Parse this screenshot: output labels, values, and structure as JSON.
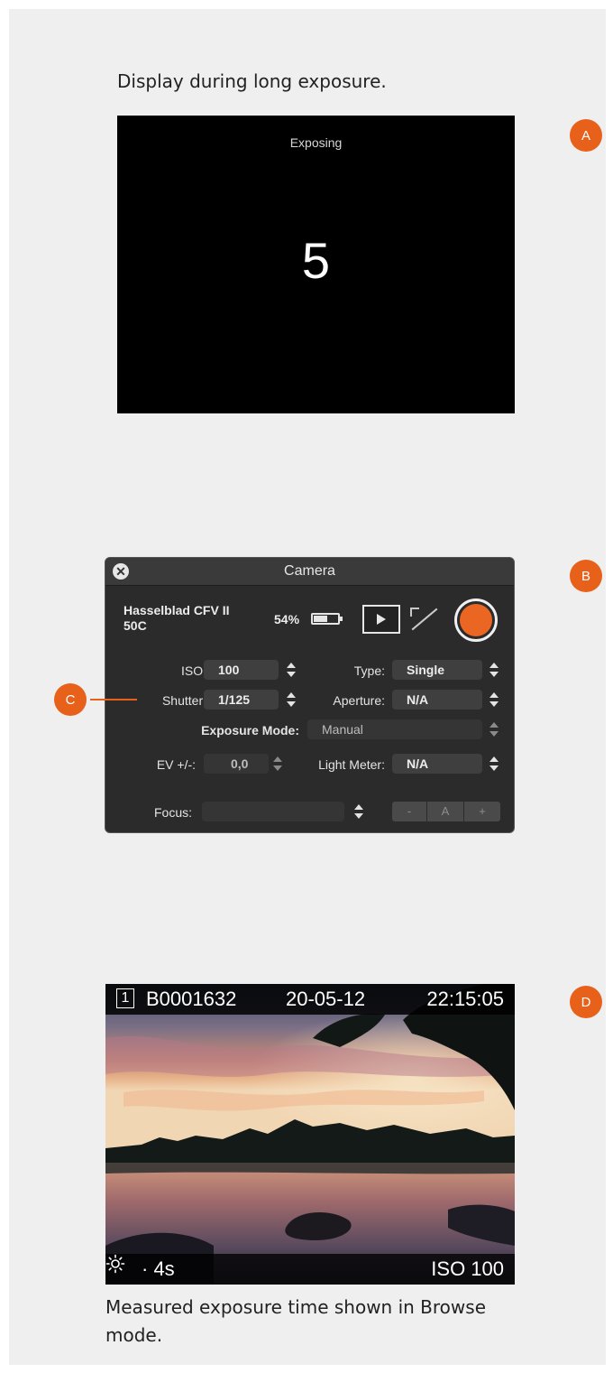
{
  "captions": {
    "top": "Display during long exposure.",
    "bottom": "Measured exposure time shown in Browse mode."
  },
  "badges": {
    "a": "A",
    "b": "B",
    "c": "C",
    "d": "D"
  },
  "screen_a": {
    "status": "Exposing",
    "countdown": "5"
  },
  "panel": {
    "title": "Camera",
    "camera_name": "Hasselblad CFV II 50C",
    "battery_pct": "54%",
    "battery_level": 0.54,
    "iso_label": "ISO:",
    "iso_value": "100",
    "type_label": "Type:",
    "type_value": "Single",
    "shutter_label": "Shutter:",
    "shutter_value": "1/125",
    "aperture_label": "Aperture:",
    "aperture_value": "N/A",
    "exposure_mode_label": "Exposure Mode:",
    "exposure_mode_value": "Manual",
    "ev_label": "EV +/-:",
    "ev_value": "0,0",
    "light_meter_label": "Light Meter:",
    "light_meter_value": "N/A",
    "focus_label": "Focus:",
    "focus_value": "",
    "focus_minus": "-",
    "focus_auto": "A",
    "focus_plus": "+"
  },
  "photo": {
    "slot": "1",
    "image_name": "B0001632",
    "date": "20-05-12",
    "time": "22:15:05",
    "exposure_time": "· 4s",
    "iso": "ISO 100",
    "mode_icon": "sun-icon"
  },
  "colors": {
    "accent": "#e8611a",
    "panel_bg": "#2b2b2b",
    "capture": "#ea6622"
  }
}
